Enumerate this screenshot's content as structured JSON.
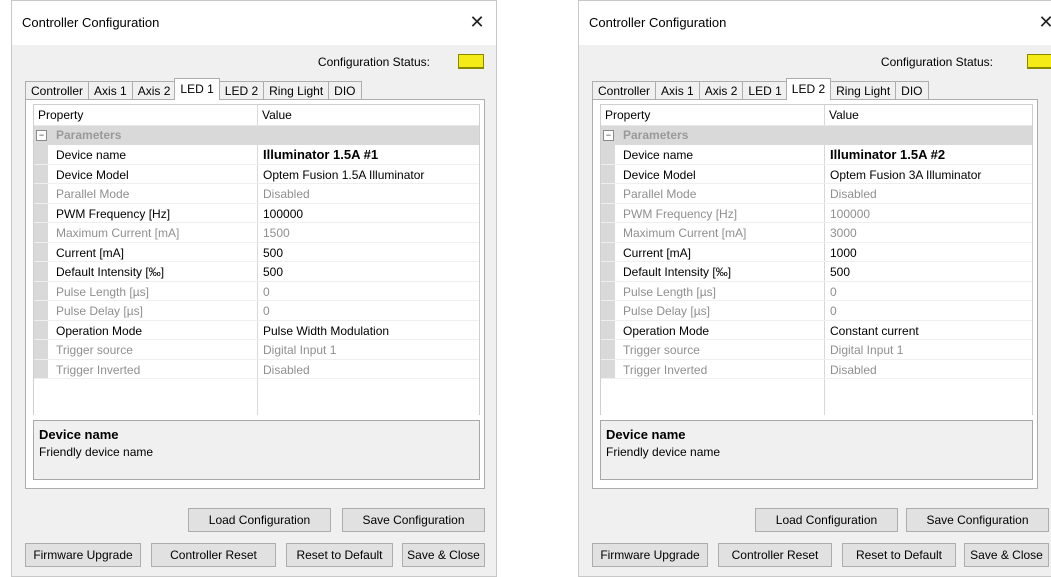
{
  "dialogs": [
    {
      "title": "Controller Configuration",
      "close_glyph": "✕",
      "status_label": "Configuration Status:",
      "status_color": "#f5eb17",
      "tabs": [
        "Controller",
        "Axis 1",
        "Axis 2",
        "LED 1",
        "LED 2",
        "Ring Light",
        "DIO"
      ],
      "active_tab": "LED 1",
      "grid": {
        "col_property": "Property",
        "col_value": "Value",
        "category": "Parameters",
        "category_toggle": "−",
        "rows": [
          {
            "name": "Device name",
            "value": "Illuminator 1.5A #1",
            "enabled": true,
            "bold": true
          },
          {
            "name": "Device Model",
            "value": "Optem Fusion 1.5A Illuminator",
            "enabled": true,
            "bold": false
          },
          {
            "name": "Parallel Mode",
            "value": "Disabled",
            "enabled": false,
            "bold": false
          },
          {
            "name": "PWM Frequency [Hz]",
            "value": "100000",
            "enabled": true,
            "bold": false
          },
          {
            "name": "Maximum Current [mA]",
            "value": "1500",
            "enabled": false,
            "bold": false
          },
          {
            "name": "Current [mA]",
            "value": "500",
            "enabled": true,
            "bold": false
          },
          {
            "name": "Default Intensity [‰]",
            "value": "500",
            "enabled": true,
            "bold": false
          },
          {
            "name": "Pulse Length [µs]",
            "value": "0",
            "enabled": false,
            "bold": false
          },
          {
            "name": "Pulse Delay [µs]",
            "value": "0",
            "enabled": false,
            "bold": false
          },
          {
            "name": "Operation Mode",
            "value": "Pulse Width Modulation",
            "enabled": true,
            "bold": false
          },
          {
            "name": "Trigger source",
            "value": "Digital Input 1",
            "enabled": false,
            "bold": false
          },
          {
            "name": "Trigger Inverted",
            "value": "Disabled",
            "enabled": false,
            "bold": false
          }
        ]
      },
      "description": {
        "title": "Device name",
        "text": "Friendly device name"
      },
      "buttons": {
        "load": "Load Configuration",
        "save": "Save Configuration",
        "firmware": "Firmware Upgrade",
        "reset": "Controller Reset",
        "default": "Reset to Default",
        "save_close": "Save & Close"
      }
    },
    {
      "title": "Controller Configuration",
      "close_glyph": "✕",
      "status_label": "Configuration Status:",
      "status_color": "#f5eb17",
      "tabs": [
        "Controller",
        "Axis 1",
        "Axis 2",
        "LED 1",
        "LED 2",
        "Ring Light",
        "DIO"
      ],
      "active_tab": "LED 2",
      "grid": {
        "col_property": "Property",
        "col_value": "Value",
        "category": "Parameters",
        "category_toggle": "−",
        "rows": [
          {
            "name": "Device name",
            "value": "Illuminator 1.5A #2",
            "enabled": true,
            "bold": true
          },
          {
            "name": "Device Model",
            "value": "Optem Fusion 3A Illuminator",
            "enabled": true,
            "bold": false
          },
          {
            "name": "Parallel Mode",
            "value": "Disabled",
            "enabled": false,
            "bold": false
          },
          {
            "name": "PWM Frequency [Hz]",
            "value": "100000",
            "enabled": false,
            "bold": false
          },
          {
            "name": "Maximum Current [mA]",
            "value": "3000",
            "enabled": false,
            "bold": false
          },
          {
            "name": "Current [mA]",
            "value": "1000",
            "enabled": true,
            "bold": false
          },
          {
            "name": "Default Intensity [‰]",
            "value": "500",
            "enabled": true,
            "bold": false
          },
          {
            "name": "Pulse Length [µs]",
            "value": "0",
            "enabled": false,
            "bold": false
          },
          {
            "name": "Pulse Delay [µs]",
            "value": "0",
            "enabled": false,
            "bold": false
          },
          {
            "name": "Operation Mode",
            "value": "Constant current",
            "enabled": true,
            "bold": false
          },
          {
            "name": "Trigger source",
            "value": "Digital Input 1",
            "enabled": false,
            "bold": false
          },
          {
            "name": "Trigger Inverted",
            "value": "Disabled",
            "enabled": false,
            "bold": false
          }
        ]
      },
      "description": {
        "title": "Device name",
        "text": "Friendly device name"
      },
      "buttons": {
        "load": "Load Configuration",
        "save": "Save Configuration",
        "firmware": "Firmware Upgrade",
        "reset": "Controller Reset",
        "default": "Reset to Default",
        "save_close": "Save & Close"
      }
    }
  ]
}
